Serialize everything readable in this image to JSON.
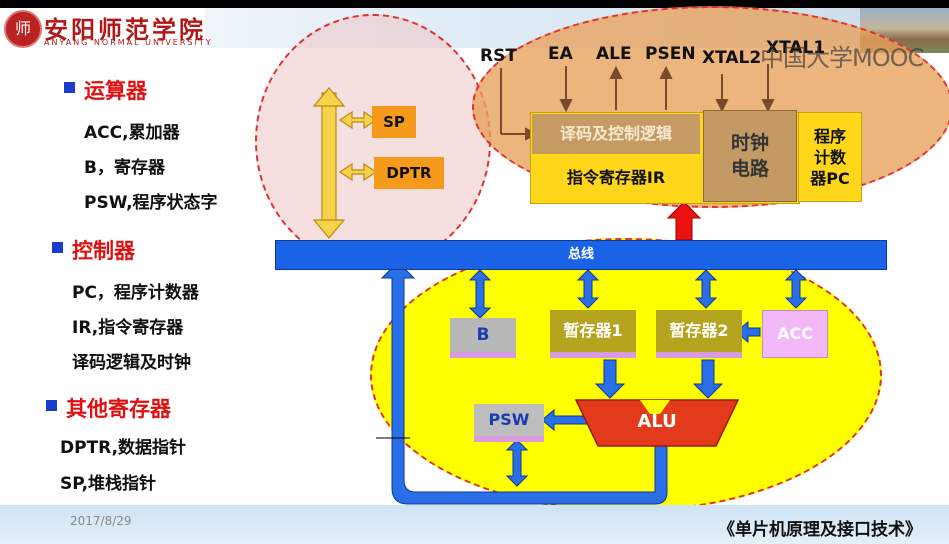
{
  "logo": {
    "seal": "师",
    "name_cn": "安阳师范学院",
    "name_en": "ANYANG NORMAL UNIVERSITY"
  },
  "watermark": "中国大学MOOC",
  "sections": [
    {
      "heading": "运算器",
      "items": [
        "ACC,累加器",
        "B，寄存器",
        "PSW,程序状态字"
      ]
    },
    {
      "heading": "控制器",
      "items": [
        "PC，程序计数器",
        "IR,指令寄存器",
        "译码逻辑及时钟"
      ]
    },
    {
      "heading": "其他寄存器",
      "items": [
        "DPTR,数据指针",
        "SP,堆栈指针"
      ]
    }
  ],
  "diagram": {
    "signals": [
      "RST",
      "EA",
      "ALE",
      "PSEN",
      "XTAL2",
      "XTAL1"
    ],
    "decode": "译码及控制逻辑",
    "ir": "指令寄存器IR",
    "clock": "时钟\n电路",
    "pc": "程序\n计数\n器PC",
    "sp": "SP",
    "dptr": "DPTR",
    "bus": "总线",
    "b": "B",
    "temp1": "暂存器1",
    "temp2": "暂存器2",
    "acc": "ACC",
    "alu": "ALU",
    "psw": "PSW"
  },
  "footer": {
    "date": "2017/8/29",
    "book": "《单片机原理及接口技术》"
  },
  "colors": {
    "bus": "#1a63e6",
    "heading": "#e01010",
    "bullet": "#1a3ccc",
    "register": "#f59a1b"
  }
}
